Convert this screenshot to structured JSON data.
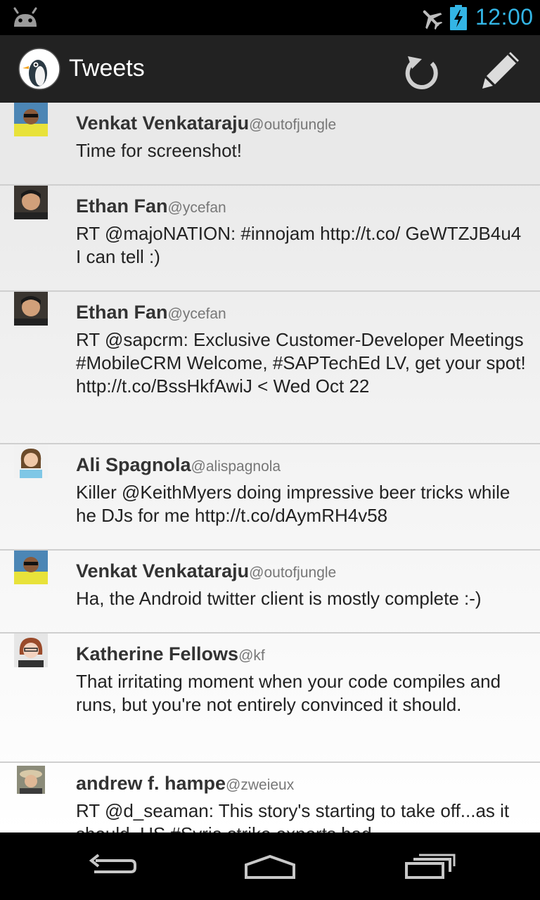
{
  "status_bar": {
    "time": "12:00",
    "icons": [
      "android-icon",
      "airplane-mode-icon",
      "battery-charging-icon"
    ],
    "accent_color": "#33b5e5"
  },
  "action_bar": {
    "title": "Tweets",
    "logo_icon": "penguin-logo-icon",
    "actions": [
      "refresh-icon",
      "compose-pencil-icon"
    ]
  },
  "tweets": [
    {
      "name": "Venkat Venkataraju",
      "handle": "@outofjungle",
      "text": "Time for screenshot!"
    },
    {
      "name": "Ethan Fan",
      "handle": "@ycefan",
      "text": "RT @majoNATION: #innojam http://t.co/ GeWTZJB4u4 I can tell :)"
    },
    {
      "name": "Ethan Fan",
      "handle": "@ycefan",
      "text": "RT @sapcrm: Exclusive Customer-Developer Meetings #MobileCRM Welcome, #SAPTechEd LV, get your spot! http://t.co/BssHkfAwiJ < Wed Oct 22"
    },
    {
      "name": "Ali Spagnola",
      "handle": "@alispagnola",
      "text": "Killer @KeithMyers doing impressive beer tricks while he DJs for me http://t.co/dAymRH4v58"
    },
    {
      "name": "Venkat Venkataraju",
      "handle": "@outofjungle",
      "text": "Ha, the Android twitter client is mostly complete :-)"
    },
    {
      "name": "Katherine Fellows",
      "handle": "@kf",
      "text": "That irritating moment when your code compiles and runs, but you're not entirely convinced it should."
    },
    {
      "name": "andrew f. hampe",
      "handle": "@zweieux",
      "text": "RT @d_seaman: This story's starting to take off...as it should. US #Syria strike experts had"
    }
  ],
  "nav_bar": {
    "buttons": [
      "back-icon",
      "home-icon",
      "recent-apps-icon"
    ]
  }
}
